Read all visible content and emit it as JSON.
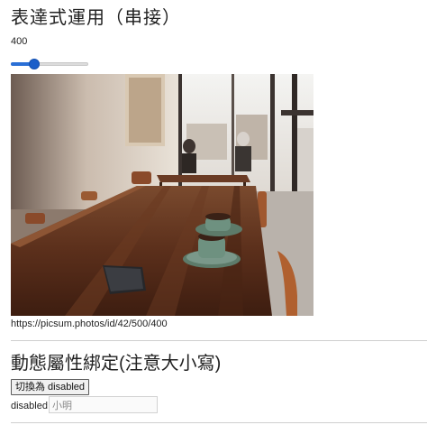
{
  "section_expression": {
    "title": "表達式運用（串接）",
    "value_text": "400",
    "slider": {
      "value": 400,
      "min": 100,
      "max": 1200
    }
  },
  "image": {
    "caption": "https://picsum.photos/id/42/500/400"
  },
  "section_binding": {
    "title": "動態屬性綁定(注意大小寫)",
    "toggle_button_label": "切換為 disabled",
    "disabled_label": "disabled",
    "input_value": "小明"
  },
  "colors": {
    "accent": "#1a5ec9",
    "text": "#222222",
    "divider": "#cfcfcf"
  }
}
